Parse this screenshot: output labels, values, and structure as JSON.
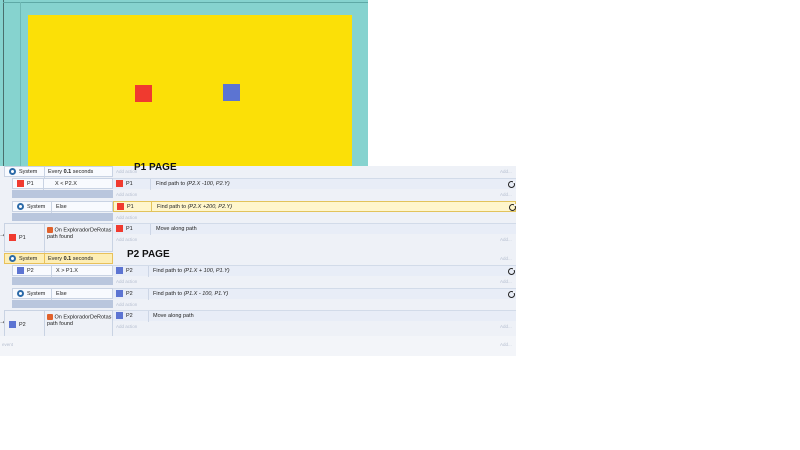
{
  "colors": {
    "p1": "#f03a2f",
    "p2": "#5c74d2",
    "layout_bg": "#86d3cf",
    "layout_area": "#fbe007",
    "highlight": "#fdeeb5"
  },
  "p1_page": {
    "title": "P1 PAGE",
    "event1": {
      "sys_label": "System",
      "every_prefix": "Every ",
      "every_value": "0.1",
      "every_suffix": " seconds",
      "sub_obj": "P1",
      "sub_cond": "X < P2.X",
      "action_obj": "P1",
      "action_prefix": "Find path to ",
      "action_args": "(P2.X -100, P2.Y)"
    },
    "else_event": {
      "sys_label": "System",
      "cond": "Else",
      "action_obj": "P1",
      "action_prefix": "Find path to ",
      "action_args": "(P2.X +200, P2.Y)"
    },
    "trigger": {
      "obj": "P1",
      "text": "On ExploradorDeRotas path found",
      "action_obj": "P1",
      "action": "Move along path"
    }
  },
  "p2_page": {
    "title": "P2 PAGE",
    "event1": {
      "sys_label": "System",
      "every_prefix": "Every ",
      "every_value": "0.1",
      "every_suffix": " seconds",
      "sub_obj": "P2",
      "sub_cond": "X > P1.X",
      "action_obj": "P2",
      "action_prefix": "Find path to ",
      "action_args": "(P1.X + 100, P1.Y)"
    },
    "else_event": {
      "sys_label": "System",
      "cond": "Else",
      "action_obj": "P2",
      "action_prefix": "Find path to ",
      "action_args": "(P1.X - 100, P1.Y)"
    },
    "trigger": {
      "obj": "P2",
      "text": "On ExploradorDeRotas path found",
      "action_obj": "P2",
      "action": "Move along path"
    }
  },
  "faint": {
    "add_action": "Add action",
    "add": "Add...",
    "event": "event"
  }
}
